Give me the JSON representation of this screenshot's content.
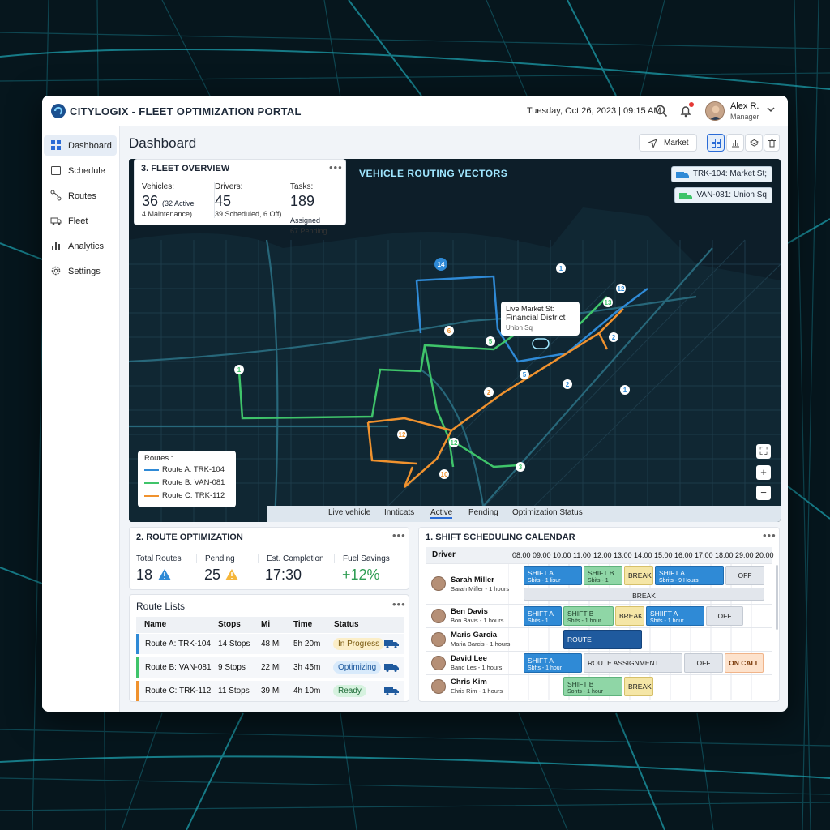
{
  "app": {
    "title": "CITYLOGIX - FLEET OPTIMIZATION PORTAL",
    "datetime": "Tuesday, Oct 26, 2023 | 09:15 AM",
    "user": {
      "name": "Alex R.",
      "role": "Manager"
    }
  },
  "sidebar": {
    "items": [
      {
        "label": "Dashboard",
        "icon": "grid-icon",
        "active": true
      },
      {
        "label": "Schedule",
        "icon": "calendar-icon"
      },
      {
        "label": "Routes",
        "icon": "route-icon"
      },
      {
        "label": "Fleet",
        "icon": "truck-icon"
      },
      {
        "label": "Analytics",
        "icon": "bar-chart-icon"
      },
      {
        "label": "Settings",
        "icon": "gear-icon"
      }
    ]
  },
  "page": {
    "title": "Dashboard",
    "market_button": "Market"
  },
  "fleet_overview": {
    "title": "3. FLEET OVERVIEW",
    "vehicles": {
      "label": "Vehicles:",
      "value": "36",
      "detail": "(32 Active",
      "sub": "4 Maintenance)"
    },
    "drivers": {
      "label": "Drivers:",
      "value": "45",
      "sub": "39 Scheduled, 6 Off)"
    },
    "tasks": {
      "label": "Tasks:",
      "value": "189",
      "detail": "Assigned",
      "sub": "67 Pending"
    }
  },
  "map": {
    "title": "VEHICLE ROUTING VECTORS",
    "tags": [
      "TRK-104: Market St;",
      "VAN-081: Union Sq"
    ],
    "popup": {
      "line1": "Live Market St:",
      "line2": "Financial District",
      "line3": "Union Sq"
    },
    "legend": {
      "title": "Routes :",
      "items": [
        {
          "label": "Route A: TRK-104",
          "color": "#2f8ad6"
        },
        {
          "label": "Route B: VAN-081",
          "color": "#3fc46a"
        },
        {
          "label": "Route C: TRK-112",
          "color": "#f0922e"
        }
      ]
    },
    "tabs": [
      "Live vehicle",
      "Innticats",
      "Active",
      "Pending",
      "Optimization Status"
    ],
    "active_tab": "Active",
    "markers": [
      "14",
      "1",
      "12",
      "13",
      "2",
      "5",
      "5",
      "12",
      "2",
      "12",
      "10",
      "3",
      "1",
      "1",
      "2",
      "1"
    ]
  },
  "route_optimization": {
    "title": "2. ROUTE OPTIMIZATION",
    "stats": [
      {
        "label": "Total Routes",
        "value": "18"
      },
      {
        "label": "Pending",
        "value": "25"
      },
      {
        "label": "Est. Completion",
        "value": "17:30"
      },
      {
        "label": "Fuel Savings",
        "value": "+12%"
      }
    ]
  },
  "route_lists": {
    "title": "Route Lists",
    "columns": [
      "Name",
      "Stops",
      "Mi",
      "Time",
      "Status"
    ],
    "rows": [
      {
        "name": "Route A: TRK-104",
        "stops": "14 Stops",
        "mi": "48 Mi",
        "time": "5h 20m",
        "status": "In Progress",
        "color": "#2f8ad6"
      },
      {
        "name": "Route B: VAN-081",
        "stops": "9 Stops",
        "mi": "22 Mi",
        "time": "3h 45m",
        "status": "Optimizing",
        "color": "#3fc46a"
      },
      {
        "name": "Route C: TRK-112",
        "stops": "11 Stops",
        "mi": "39 Mi",
        "time": "4h 10m",
        "status": "Ready",
        "color": "#f0922e"
      }
    ]
  },
  "calendar": {
    "title": "1. SHIFT SCHEDULING CALENDAR",
    "driver_header": "Driver",
    "hours": [
      "08:00",
      "09:00",
      "10:00",
      "11:00",
      "12:00",
      "13:00",
      "14:00",
      "15:00",
      "16:00",
      "17:00",
      "18:00",
      "29:00",
      "20:00"
    ],
    "drivers": [
      {
        "name": "Sarah Miller",
        "sub": "Sarah Mifler - 1 hours"
      },
      {
        "name": "Ben Davis",
        "sub": "Bon Bavis - 1 hours"
      },
      {
        "name": "Maris Garcia",
        "sub": "Maria Barcis - 1 hours"
      },
      {
        "name": "David Lee",
        "sub": "Band Les - 1 hours"
      },
      {
        "name": "Chris Kim",
        "sub": "Ehris Rim - 1 hours"
      }
    ],
    "blocks": {
      "shift_a": "SHIFT A",
      "shift_a_sub": "Sbits - 1 lisur",
      "shift_b": "SHIFT B",
      "shift_b_sub": "Sbits - 1 hour",
      "break": "BREAK",
      "shift_a2": "SHIFT A",
      "shift_a2_sub": "Sbrits - 9 Hours",
      "off": "OFF",
      "row2_shift_a": "SHIFT A",
      "row2_shift_a_sub": "Sbits - 1 hour",
      "row2_shift_b": "SHIFT B",
      "row2_shift_b_sub": "Sbits - 1 hour",
      "row2_shift_a2": "SHIIFT A",
      "row2_shift_a2_sub": "Sbits - 1 hour",
      "route_assignment": "ROUTE ASSIGNMENT",
      "row4_shift_a": "SHIFT A",
      "row4_shift_a_sub": "Sbfts - 1 hour",
      "on_call": "ON CALL",
      "row5_shift_b": "SHIFT B",
      "row5_shift_b_sub": "Sonts - 1 hour"
    }
  },
  "colors": {
    "route_a": "#2f8ad6",
    "route_b": "#3fc46a",
    "route_c": "#f0922e",
    "accent": "#2a6bd6"
  }
}
